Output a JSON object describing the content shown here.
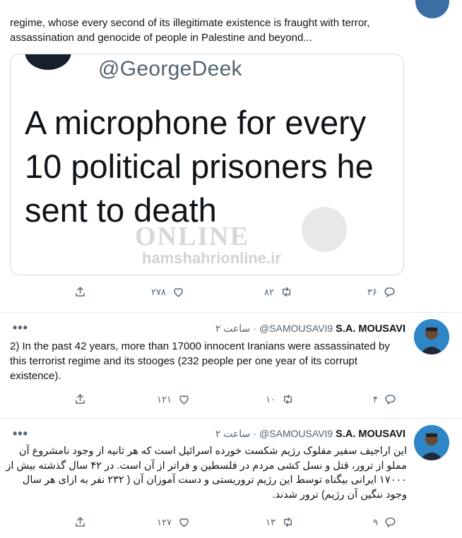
{
  "tweet1": {
    "text": "regime, whose every second of its illegitimate existence is fraught with terror, assassination and genocide of people in Palestine and beyond...",
    "quote_image": {
      "handle": "@GeorgeDeek",
      "headline": "A microphone for every 10 political prisoners he sent to death",
      "watermark_logo": "ONLINE",
      "watermark_site": "hamshahrionline.ir"
    },
    "actions": {
      "replies": "۳۶",
      "retweets": "۸۲",
      "likes": "۲۷۸"
    }
  },
  "tweet2": {
    "name": "S.A. MOUSAVI",
    "handle": "@SAMOUSAVI9",
    "time": "۲ ساعت",
    "text": "2) In the past 42 years, more than 17000 innocent Iranians were assassinated by this terrorist regime and its stooges (232 people per one year of its corrupt existence).",
    "actions": {
      "replies": "۴",
      "retweets": "۱۰",
      "likes": "۱۲۱"
    }
  },
  "tweet3": {
    "name": "S.A. MOUSAVI",
    "handle": "@SAMOUSAVI9",
    "time": "۲ ساعت",
    "text": "این اراجیف سفیر مفلوک رژیم شکست خورده اسرائیل است که هر ثانیه از وجود نامشروع آن مملو از ترور، قتل و نسل کشی مردم در فلسطین و فراتر از آن است. در ۴۲ سال گذشته بیش از ۱۷۰۰۰ ایرانی بیگناه توسط این رژیم تروریستی و دست آموزان آن ( ۲۳۲ نفر به ازای هر سال وجود ننگین آن رژیم) ترور شدند.",
    "actions": {
      "replies": "۹",
      "retweets": "۱۳",
      "likes": "۱۲۷"
    }
  },
  "ui": {
    "more_glyph": "•••",
    "separator": "·"
  },
  "colors": {
    "text": "#0f1419",
    "muted": "#536471",
    "border": "#cfd9de",
    "divider": "#e6ecf0"
  }
}
